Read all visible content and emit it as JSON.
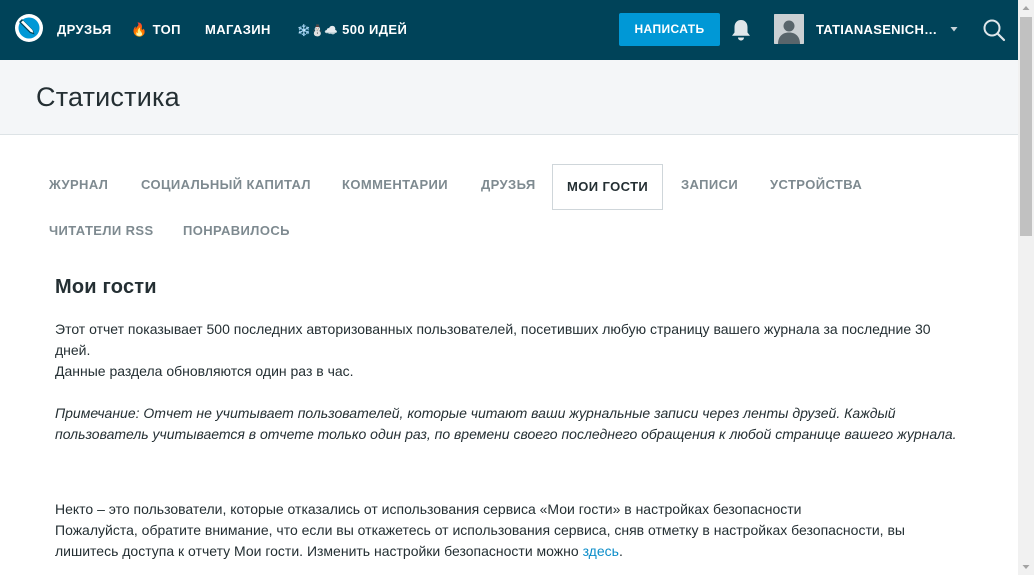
{
  "navbar": {
    "items": [
      {
        "label": "ДРУЗЬЯ"
      },
      {
        "icon": "🔥",
        "label": "ТОП"
      },
      {
        "label": "МАГАЗИН"
      },
      {
        "icon": "❄️⛄☁️",
        "label": "500 ИДЕЙ"
      }
    ],
    "write_button": "НАПИСАТЬ",
    "username": "TATIANASENICH…",
    "icons": [
      "lj-logo-icon",
      "bell-icon",
      "user-avatar",
      "chevron-down-icon",
      "search-icon"
    ]
  },
  "page": {
    "title": "Статистика"
  },
  "tabs": [
    {
      "label": "ЖУРНАЛ",
      "active": false
    },
    {
      "label": "СОЦИАЛЬНЫЙ КАПИТАЛ",
      "active": false
    },
    {
      "label": "КОММЕНТАРИИ",
      "active": false
    },
    {
      "label": "ДРУЗЬЯ",
      "active": false
    },
    {
      "label": "МОИ ГОСТИ",
      "active": true
    },
    {
      "label": "ЗАПИСИ",
      "active": false
    },
    {
      "label": "УСТРОЙСТВА",
      "active": false
    },
    {
      "label": "ЧИТАТЕЛИ RSS",
      "active": false
    },
    {
      "label": "ПОНРАВИЛОСЬ",
      "active": false
    }
  ],
  "content": {
    "title": "Мои гости",
    "intro_line1": "Этот отчет показывает 500 последних авторизованных пользователей, посетивших любую страницу вашего журнала за последние 30 дней.",
    "intro_line2": "Данные раздела обновляются один раз в час.",
    "note": "Примечание: Отчет не учитывает пользователей, которые читают ваши журнальные записи через ленты друзей. Каждый пользователь учитывается в отчете только один раз, по времени своего последнего обращения к любой странице вашего журнала.",
    "someone_line": "Некто – это пользователи, которые отказались от использования сервиса «Мои гости» в настройках безопасности",
    "warning_text": "Пожалуйста, обратите внимание, что если вы откажетесь от использования сервиса, сняв отметку в настройках безопасности, вы лишитесь доступа к отчету Мои гости. Изменить настройки безопасности можно ",
    "link_text": "здесь",
    "warning_end": "."
  },
  "colors": {
    "navbar_bg": "#004359",
    "accent": "#0098d6",
    "link": "#0c8dc9",
    "header_bg": "#f4f6f8"
  }
}
